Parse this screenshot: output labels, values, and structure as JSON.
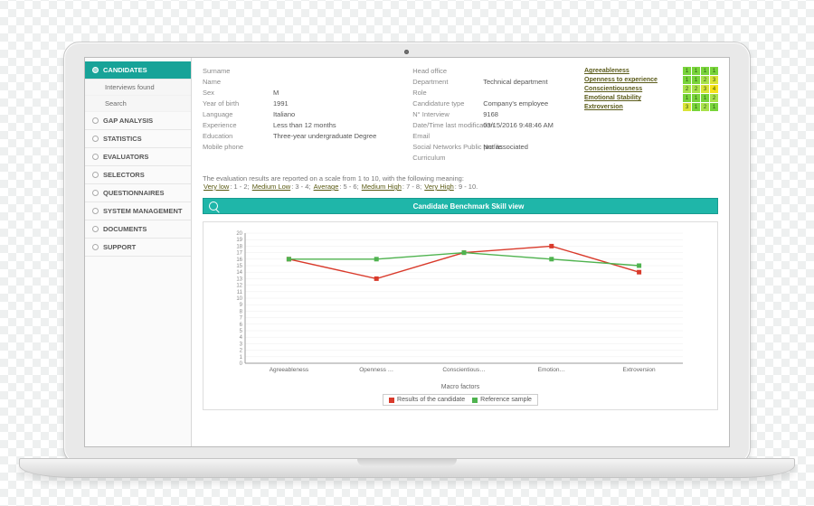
{
  "sidebar": {
    "items": [
      {
        "label": "CANDIDATES",
        "active": true
      },
      {
        "label": "GAP ANALYSIS"
      },
      {
        "label": "STATISTICS"
      },
      {
        "label": "EVALUATORS"
      },
      {
        "label": "SELECTORS"
      },
      {
        "label": "QUESTIONNAIRES"
      },
      {
        "label": "SYSTEM MANAGEMENT"
      },
      {
        "label": "DOCUMENTS"
      },
      {
        "label": "SUPPORT"
      }
    ],
    "subitems": [
      {
        "label": "Interviews found"
      },
      {
        "label": "Search"
      }
    ]
  },
  "details": {
    "col1": [
      {
        "label": "Surname",
        "value": ""
      },
      {
        "label": "Name",
        "value": ""
      },
      {
        "label": "Sex",
        "value": "M"
      },
      {
        "label": "Year of birth",
        "value": "1991"
      },
      {
        "label": "Language",
        "value": "Italiano"
      },
      {
        "label": "Experience",
        "value": "Less than 12 months"
      },
      {
        "label": "Education",
        "value": "Three-year undergraduate Degree"
      },
      {
        "label": "Mobile phone",
        "value": ""
      }
    ],
    "col2": [
      {
        "label": "Head office",
        "value": ""
      },
      {
        "label": "Department",
        "value": "Technical department"
      },
      {
        "label": "Role",
        "value": ""
      },
      {
        "label": "Candidature type",
        "value": "Company's employee"
      },
      {
        "label": "N° Interview",
        "value": "9168"
      },
      {
        "label": "Date/Time last modification",
        "value": "03/15/2016 9:48:46 AM"
      },
      {
        "label": "Email",
        "value": ""
      },
      {
        "label": "Social Networks Public profile",
        "value": "Not associated"
      },
      {
        "label": "Curriculum",
        "value": ""
      }
    ]
  },
  "traits": {
    "rows": [
      {
        "label": "Agreeableness",
        "cells": [
          1,
          1,
          1,
          1
        ]
      },
      {
        "label": "Openness to experience",
        "cells": [
          1,
          1,
          2,
          3
        ]
      },
      {
        "label": "Conscientiousness",
        "cells": [
          2,
          2,
          3,
          4
        ]
      },
      {
        "label": "Emotional Stability",
        "cells": [
          1,
          1,
          1,
          2
        ]
      },
      {
        "label": "Extroversion",
        "cells": [
          3,
          1,
          2,
          1
        ]
      }
    ],
    "colors": {
      "1": "#78d43a",
      "2": "#a9e24a",
      "3": "#d9e437",
      "4": "#f6e21a"
    }
  },
  "scale_note": {
    "prefix": "The evaluation results are reported on a scale from 1 to 10, with the following meaning:",
    "items": [
      "Very low",
      "1 - 2",
      "Medium Low",
      "3 - 4",
      "Average",
      "5 - 6",
      "Medium High",
      "7 - 8",
      "Very High",
      "9 - 10"
    ]
  },
  "chart_header": "Candidate Benchmark Skill view",
  "chart_xaxis_label": "Macro factors",
  "legend": {
    "a": "Results of the candidate",
    "b": "Reference sample"
  },
  "chart_data": {
    "type": "line",
    "categories": [
      "Agreeableness",
      "Openness …",
      "Conscientious…",
      "Emotion…",
      "Extroversion"
    ],
    "series": [
      {
        "name": "Results of the candidate",
        "color": "#d93a2b",
        "values": [
          16,
          13,
          17,
          18,
          14
        ]
      },
      {
        "name": "Reference sample",
        "color": "#4fb34f",
        "values": [
          16,
          16,
          17,
          16,
          15
        ]
      }
    ],
    "ylim": [
      0,
      20
    ],
    "yticks": [
      0,
      1,
      2,
      3,
      4,
      5,
      6,
      7,
      8,
      9,
      10,
      11,
      12,
      13,
      14,
      15,
      16,
      17,
      18,
      19,
      20
    ]
  }
}
